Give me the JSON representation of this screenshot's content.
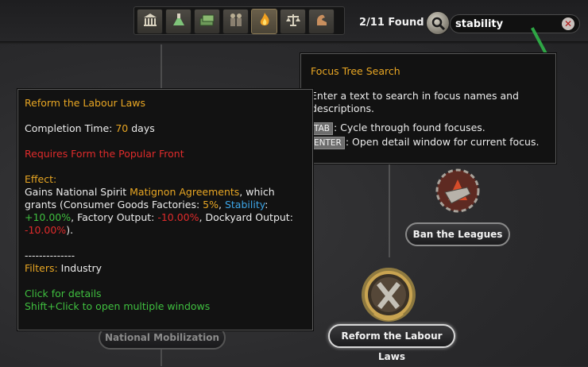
{
  "topbar": {
    "filter_buttons": [
      {
        "name": "political-filter-button",
        "icon": "bank-icon",
        "glyph": "🏛"
      },
      {
        "name": "research-filter-button",
        "icon": "flask-icon",
        "glyph": "⚗"
      },
      {
        "name": "industry-filter-button",
        "icon": "money-icon",
        "glyph": "💵"
      },
      {
        "name": "army-filter-button",
        "icon": "soldiers-icon",
        "glyph": "👥"
      },
      {
        "name": "stability-filter-button",
        "icon": "fire-icon",
        "glyph": "🔥"
      },
      {
        "name": "diplomacy-filter-button",
        "icon": "scales-icon",
        "glyph": "⚖"
      },
      {
        "name": "manpower-filter-button",
        "icon": "arm-icon",
        "glyph": "💪"
      }
    ],
    "found_count": "2/11 Found",
    "search_value": "stability",
    "accent_color": "#e8a623"
  },
  "search_tooltip": {
    "title": "Focus Tree Search",
    "description": "Enter a text to search in focus names and descriptions.",
    "tab_key": "TAB",
    "tab_text": ": Cycle through found focuses.",
    "enter_key": "ENTER",
    "enter_text": ": Open detail window for current focus."
  },
  "focus_tooltip": {
    "title": "Reform the Labour Laws",
    "completion_label": "Completion Time: ",
    "completion_value": "70",
    "completion_unit": " days",
    "requires": "Requires Form the Popular Front",
    "effect_label": "Effect:",
    "effect_1": "Gains National Spirit ",
    "spirit_name": "Matignon Agreements",
    "effect_2": ", which grants (Consumer Goods Factories: ",
    "cgf_value": "5%",
    "effect_3": ", ",
    "stability_label": "Stability",
    "effect_4": ": ",
    "stability_value": "+10.00%",
    "effect_5": ", Factory Output: ",
    "factory_value": "-10.00%",
    "effect_6": ", Dockyard Output: ",
    "dockyard_value": "-10.00%",
    "effect_7": ").",
    "separator": "--------------",
    "filters_label": "Filters:",
    "filters_value": " Industry",
    "click_hint": "Click for details",
    "shift_hint": "Shift+Click to open multiple windows"
  },
  "focuses": {
    "ban_leagues": "Ban the Leagues",
    "reform_labour": "Reform the Labour Laws",
    "national_mobilization": "National Mobilization"
  }
}
